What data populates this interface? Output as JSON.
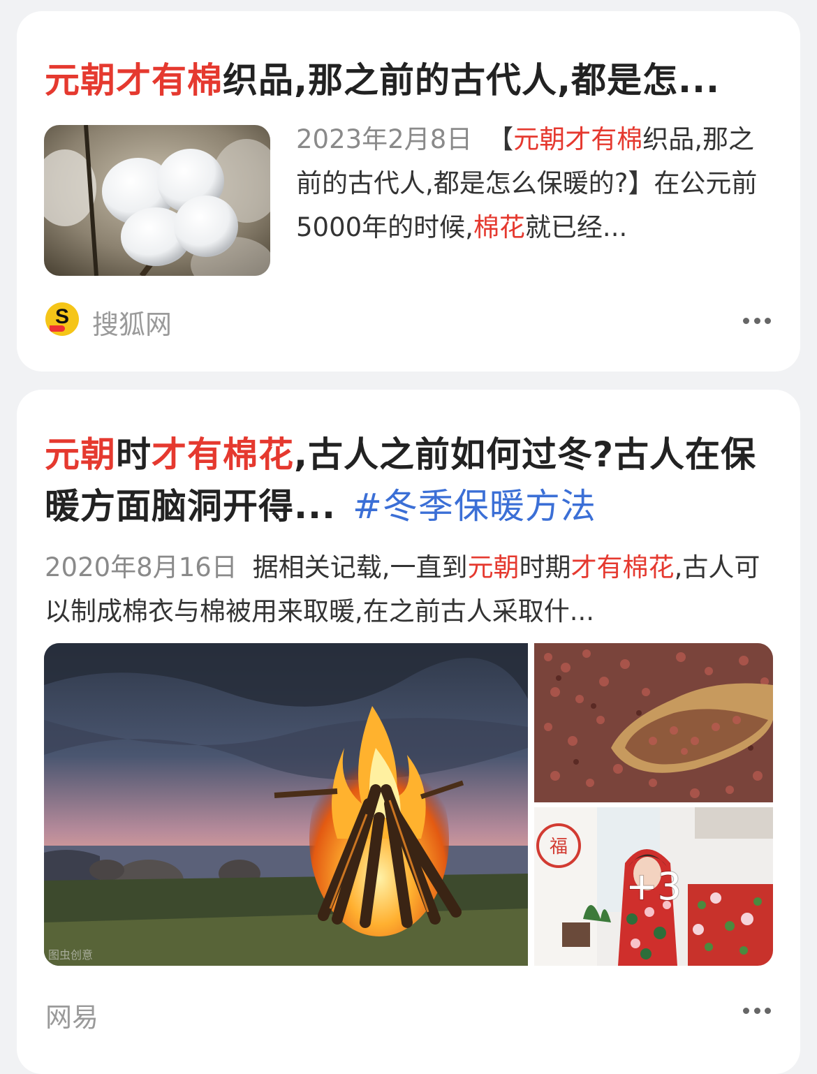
{
  "results": [
    {
      "title_parts": [
        {
          "text": "元朝才有棉",
          "hl": true
        },
        {
          "text": "织品,那之前的古代人,都是怎...",
          "hl": false
        }
      ],
      "date": "2023年2月8日",
      "snippet_parts": [
        {
          "text": "【",
          "hl": false
        },
        {
          "text": "元朝才有棉",
          "hl": true
        },
        {
          "text": "织品,那之前的古代人,都是怎么保暖的?】在公元前5000年的时候,",
          "hl": false
        },
        {
          "text": "棉花",
          "hl": true
        },
        {
          "text": "就已经...",
          "hl": false
        }
      ],
      "source_name": "搜狐网",
      "source_logo_letter": "S",
      "image_icon": "cotton-boll-photo",
      "more_icon": "more-dots-icon"
    },
    {
      "title_parts": [
        {
          "text": "元朝",
          "hl": true
        },
        {
          "text": "时",
          "hl": false
        },
        {
          "text": "才有棉花",
          "hl": true
        },
        {
          "text": ",古人之前如何过冬?古人在保暖方面脑洞开得...",
          "hl": false
        }
      ],
      "hashtag": "#冬季保暖方法",
      "date": "2020年8月16日",
      "snippet_parts": [
        {
          "text": "据相关记载,一直到",
          "hl": false
        },
        {
          "text": "元朝",
          "hl": true
        },
        {
          "text": "时期",
          "hl": false
        },
        {
          "text": "才有棉花",
          "hl": true
        },
        {
          "text": ",古人可以制成棉衣与棉被用来取暖,在之前古人采取什...",
          "hl": false
        }
      ],
      "images": [
        {
          "icon": "bonfire-photo",
          "watermark": "图虫创意"
        },
        {
          "icon": "peppercorn-photo"
        },
        {
          "icon": "girl-photo",
          "overlay": "+3"
        }
      ],
      "source_name": "网易",
      "more_icon": "more-dots-icon"
    }
  ],
  "colors": {
    "highlight": "#e5392f",
    "hashtag": "#3b6fd6",
    "background": "#f1f2f4",
    "card": "#ffffff"
  }
}
